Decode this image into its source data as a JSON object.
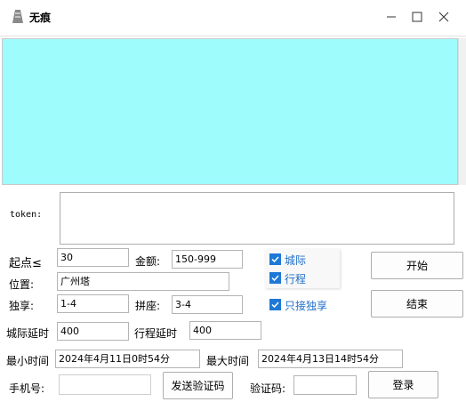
{
  "window": {
    "title": "无痕",
    "minimize_icon": "minimize-icon",
    "maximize_icon": "maximize-icon",
    "close_icon": "close-icon"
  },
  "token": {
    "label": "token:"
  },
  "fields": {
    "start_label": "起点≤",
    "start_value": "30",
    "amount_label": "金额:",
    "amount_value": "150-999",
    "position_label": "位置:",
    "position_value": "广州塔",
    "solo_label": "独享:",
    "solo_value": "1-4",
    "carpool_label": "拼座:",
    "carpool_value": "3-4",
    "intercity_delay_label": "城际延时",
    "intercity_delay_value": "400",
    "trip_delay_label": "行程延时",
    "trip_delay_value": "400",
    "min_time_label": "最小时间",
    "min_time_value": "2024年4月11日0时54分",
    "max_time_label": "最大时间",
    "max_time_value": "2024年4月13日14时54分",
    "phone_label": "手机号:",
    "phone_value": "",
    "code_label": "验证码:",
    "code_value": ""
  },
  "checkboxes": [
    {
      "label": "城际",
      "checked": true
    },
    {
      "label": "行程",
      "checked": true
    },
    {
      "label": "只接独享",
      "checked": true
    }
  ],
  "buttons": {
    "start": "开始",
    "stop": "结束",
    "send_code": "发送验证码",
    "login": "登录"
  },
  "colors": {
    "panel": "#9ffcfc",
    "checkbox": "#1e78d6"
  }
}
